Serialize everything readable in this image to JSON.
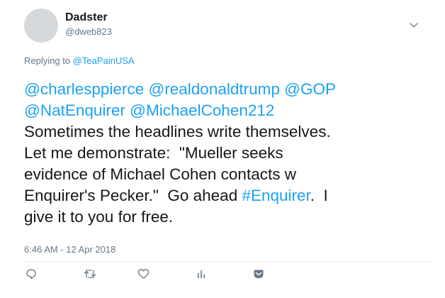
{
  "tweet": {
    "author": {
      "name": "Dadster",
      "handle": "@dweb823"
    },
    "replying": {
      "prefix": "Replying to",
      "to": "@TeaPainUSA"
    },
    "body": {
      "mention1": "@charlesppierce",
      "mention2": "@realdonaldtrump",
      "mention3": "@GOP",
      "mention4": "@NatEnquirer",
      "mention5": "@MichaelCohen212",
      "line3": "Sometimes the headlines write themselves.",
      "line4": "Let me demonstrate:  \"Mueller seeks",
      "line5": "evidence of Michael Cohen contacts w",
      "line6_pre": "Enquirer's Pecker.\"  Go ahead ",
      "hashtag": "#Enquirer",
      "line6_post": ".  I",
      "line7": "give it to you for free."
    },
    "timestamp": "6:46 AM - 12 Apr 2018",
    "icons": {
      "caret": "chevron-down-icon",
      "reply": "reply-icon",
      "retweet": "retweet-icon",
      "like": "heart-icon",
      "analytics": "analytics-icon",
      "dm": "direct-message-icon"
    },
    "colors": {
      "link": "#1da1f2",
      "secondary": "#657786",
      "text": "#14171a"
    }
  }
}
